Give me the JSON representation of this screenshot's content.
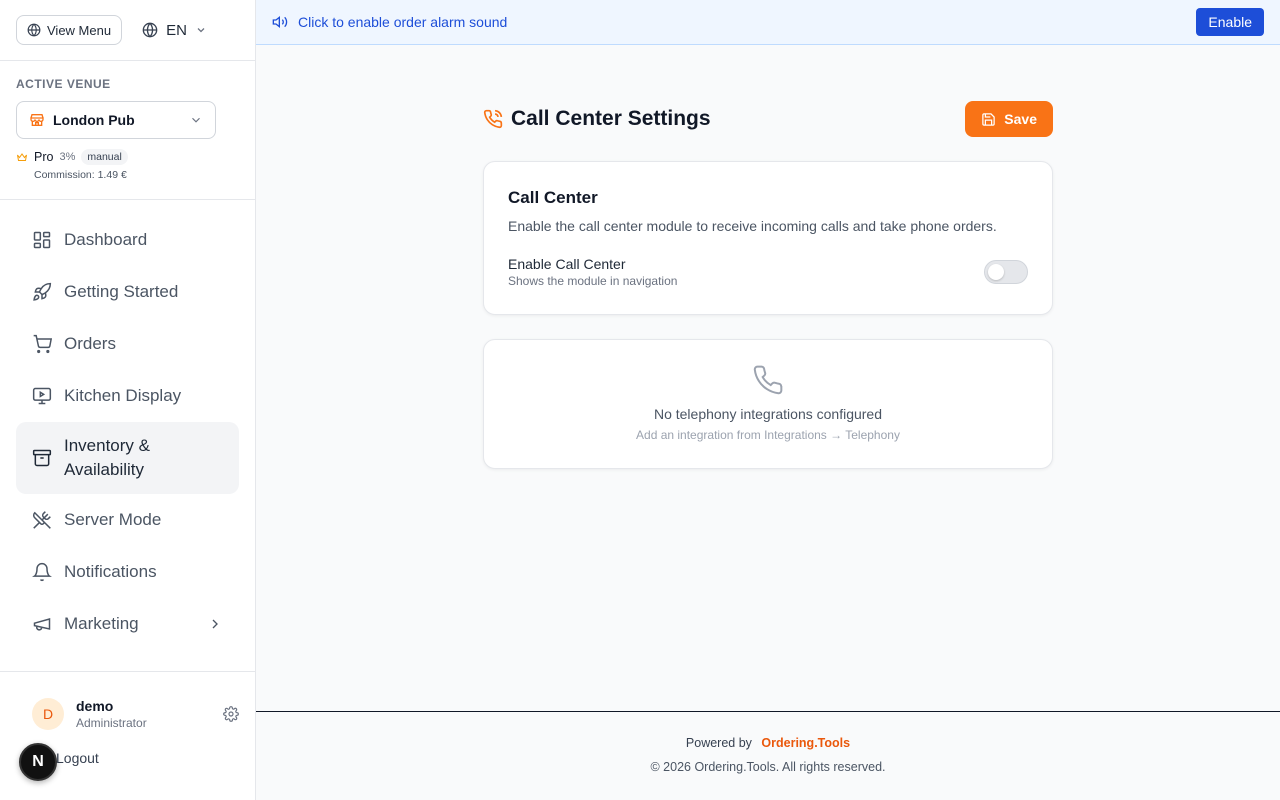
{
  "sidebar": {
    "view_menu_label": "View Menu",
    "language": "EN",
    "venue_caption": "ACTIVE VENUE",
    "venue_name": "London Pub",
    "plan": {
      "name": "Pro",
      "percent": "3%",
      "tag": "manual",
      "commission": "Commission: 1.49 €"
    },
    "items": [
      {
        "label": "Dashboard",
        "icon": "dashboard-icon"
      },
      {
        "label": "Getting Started",
        "icon": "rocket-icon"
      },
      {
        "label": "Orders",
        "icon": "cart-icon"
      },
      {
        "label": "Kitchen Display",
        "icon": "monitor-icon"
      },
      {
        "label": "Inventory & Availability",
        "icon": "archive-icon",
        "active": true
      },
      {
        "label": "Server Mode",
        "icon": "utensils-crossed-icon"
      },
      {
        "label": "Notifications",
        "icon": "bell-icon"
      },
      {
        "label": "Marketing",
        "icon": "megaphone-icon",
        "has_submenu": true
      }
    ],
    "user": {
      "initial": "D",
      "name": "demo",
      "role": "Administrator"
    },
    "logout_label": "Logout",
    "dev_badge": "N"
  },
  "banner": {
    "text": "Click to enable order alarm sound",
    "button": "Enable"
  },
  "page": {
    "title": "Call Center Settings",
    "save_label": "Save",
    "card": {
      "title": "Call Center",
      "description": "Enable the call center module to receive incoming calls and take phone orders.",
      "toggle_label": "Enable Call Center",
      "toggle_sub": "Shows the module in navigation",
      "toggle_on": false
    },
    "empty": {
      "title": "No telephony integrations configured",
      "subtitle": "Add an integration from Integrations → Telephony"
    }
  },
  "footer": {
    "powered_by": "Powered by",
    "brand": "Ordering.Tools",
    "copyright": "© 2026 Ordering.Tools. All rights reserved."
  },
  "colors": {
    "accent": "#f97316",
    "banner_blue": "#1d4ed8"
  }
}
